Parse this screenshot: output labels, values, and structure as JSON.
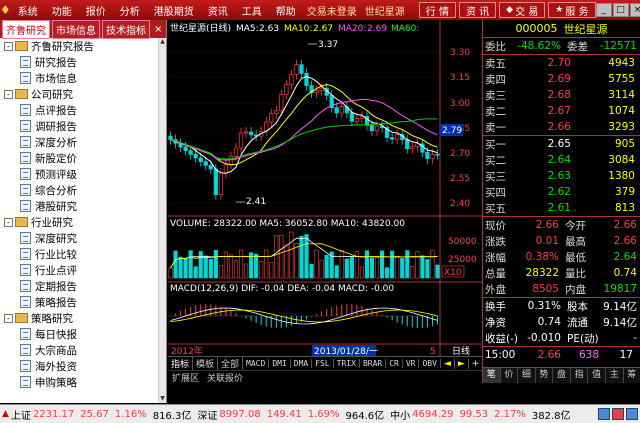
{
  "menubar": {
    "logo": "♦",
    "menus": [
      "系统",
      "功能",
      "报价",
      "分析",
      "港股期货",
      "资讯",
      "工具",
      "帮助"
    ],
    "status_login": "交易未登录",
    "status_brand": "世纪星源",
    "btn_hq": "行 情",
    "btn_zx": "资 讯",
    "btn_jy": "交 易",
    "btn_fw": "服 务",
    "win_min": "_",
    "win_max": "□",
    "win_close": "×"
  },
  "left_panel": {
    "tabs": [
      "齐鲁研究",
      "市场信息",
      "技术指标"
    ],
    "close": "×",
    "tree": [
      {
        "label": "齐鲁研究报告",
        "children": [
          "研究报告",
          "市场信息"
        ]
      },
      {
        "label": "公司研究",
        "children": [
          "点评报告",
          "调研报告",
          "深度分析",
          "新股定价",
          "预测评级",
          "综合分析",
          "港股研究"
        ]
      },
      {
        "label": "行业研究",
        "children": [
          "深度研究",
          "行业比较",
          "行业点评",
          "定期报告",
          "策略报告"
        ]
      },
      {
        "label": "策略研究",
        "children": [
          "每日快报",
          "大宗商品",
          "海外投资",
          "申购策略"
        ]
      }
    ]
  },
  "chart": {
    "header_name": "世纪星源(日线)",
    "ma5_label": "MA5:",
    "ma5": "2.63",
    "ma10_label": "MA10:",
    "ma10": "2.67",
    "ma20_label": "MA20:",
    "ma20": "2.69",
    "ma60_label": "MA60:",
    "ma60": "",
    "high_label": "3.37",
    "low_label": "2.41",
    "current_price_tag": "2.79",
    "y_ticks": [
      "3.30",
      "3.15",
      "3.00",
      "2.85",
      "2.70",
      "2.55",
      "2.40"
    ],
    "volume_label": "VOLUME: 28322.00  MA5: 36052.80  MA10: 43820.00",
    "vol_ticks": [
      "50000",
      "25000"
    ],
    "vol_unit": "X10",
    "macd_label_a": "MACD(12,26,9) DIF: -0.04 DEA: -0.04 MACD: -0.00",
    "x_year": "2012年",
    "x_date": "2013/01/28/一",
    "x_day": "5",
    "period": "日线"
  },
  "chart_tabs": [
    "指标",
    "模板",
    "全部",
    "MACD",
    "DMI",
    "DMA",
    "FSL",
    "TRIX",
    "BRAR",
    "CR",
    "VR",
    "OBV"
  ],
  "chart_tab_nav": [
    "◄",
    "►",
    "+",
    "-"
  ],
  "subtabs": [
    "扩展区",
    "关联报价"
  ],
  "quote": {
    "code": "000005",
    "name": "世纪星源",
    "weibi_label": "委比",
    "weibi": "-48.62%",
    "weicha_label": "委差",
    "weicha": "-12571",
    "asks": [
      {
        "label": "卖五",
        "price": "2.70",
        "vol": "4943"
      },
      {
        "label": "卖四",
        "price": "2.69",
        "vol": "5755"
      },
      {
        "label": "卖三",
        "price": "2.68",
        "vol": "3114"
      },
      {
        "label": "卖二",
        "price": "2.67",
        "vol": "1074"
      },
      {
        "label": "卖一",
        "price": "2.66",
        "vol": "3293"
      }
    ],
    "bids": [
      {
        "label": "买一",
        "price": "2.65",
        "vol": "905"
      },
      {
        "label": "买二",
        "price": "2.64",
        "vol": "3084"
      },
      {
        "label": "买三",
        "price": "2.63",
        "vol": "1380"
      },
      {
        "label": "买四",
        "price": "2.62",
        "vol": "379"
      },
      {
        "label": "买五",
        "price": "2.61",
        "vol": "813"
      }
    ],
    "stats": [
      {
        "l1": "现价",
        "v1": "2.66",
        "c1": "red",
        "l2": "今开",
        "v2": "2.66",
        "c2": "red"
      },
      {
        "l1": "涨跌",
        "v1": "0.01",
        "c1": "red",
        "l2": "最高",
        "v2": "2.66",
        "c2": "red"
      },
      {
        "l1": "涨幅",
        "v1": "0.38%",
        "c1": "red",
        "l2": "最低",
        "v2": "2.64",
        "c2": "green"
      },
      {
        "l1": "总量",
        "v1": "28322",
        "c1": "yellow",
        "l2": "量比",
        "v2": "0.74",
        "c2": "yellow"
      },
      {
        "l1": "外盘",
        "v1": "8505",
        "c1": "red",
        "l2": "内盘",
        "v2": "19817",
        "c2": "green"
      }
    ],
    "stats2": [
      {
        "l1": "换手",
        "v1": "0.31%",
        "l2": "股本",
        "v2": "9.14亿"
      },
      {
        "l1": "净资",
        "v1": "0.74",
        "l2": "流通",
        "v2": "9.14亿"
      },
      {
        "l1": "收益(-)",
        "v1": "-0.010",
        "l2": "PE(动)",
        "v2": "-"
      }
    ],
    "tick": {
      "time": "15:00",
      "price": "2.66",
      "vol": "638",
      "bs": "17"
    },
    "bottom_tabs": [
      "笔",
      "价",
      "细",
      "势",
      "盘",
      "指",
      "值",
      "主",
      "筹"
    ]
  },
  "statusbar": {
    "sh_label": "上证",
    "sh_val": "2231.17",
    "sh_chg": "25.67",
    "sh_pct": "1.16%",
    "sh_amt": "816.3亿",
    "sz_label": "深证",
    "sz_val": "8997.08",
    "sz_chg": "149.41",
    "sz_pct": "1.69%",
    "sz_amt": "964.6亿",
    "zx_label": "中小",
    "zx_val": "4694.29",
    "zx_chg": "99.53",
    "zx_pct": "2.17%",
    "zx_amt": "382.8亿"
  }
}
